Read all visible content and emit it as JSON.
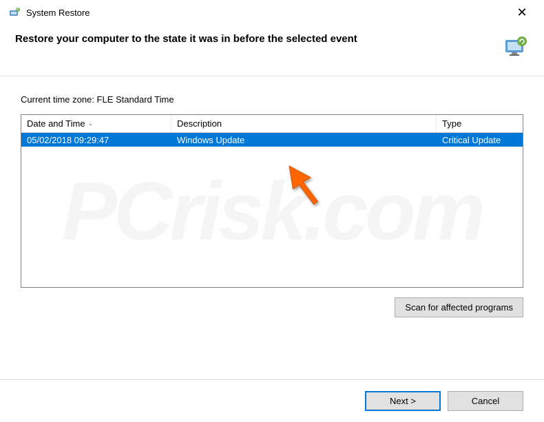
{
  "window": {
    "title": "System Restore"
  },
  "header": {
    "instruction": "Restore your computer to the state it was in before the selected event"
  },
  "content": {
    "timezone_label": "Current time zone: FLE Standard Time"
  },
  "table": {
    "columns": {
      "date": "Date and Time",
      "description": "Description",
      "type": "Type"
    },
    "rows": [
      {
        "date": "05/02/2018 09:29:47",
        "description": "Windows Update",
        "type": "Critical Update"
      }
    ]
  },
  "buttons": {
    "scan": "Scan for affected programs",
    "next": "Next >",
    "cancel": "Cancel"
  },
  "watermark": "PCrisk.com"
}
